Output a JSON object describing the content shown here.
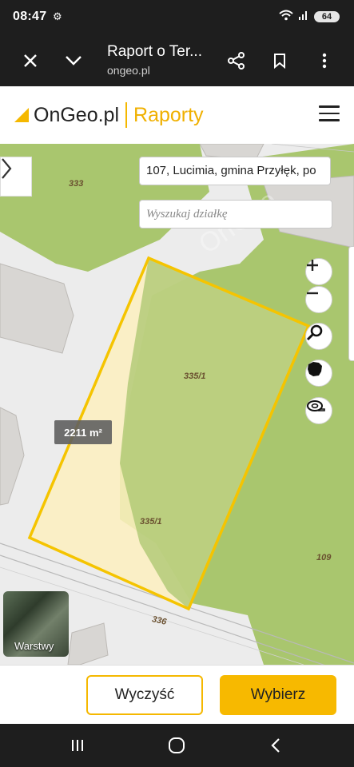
{
  "status": {
    "time": "08:47",
    "battery": "64"
  },
  "browser": {
    "title": "Raport o Ter...",
    "url": "ongeo.pl"
  },
  "header": {
    "brand": "OnGeo.pl",
    "section": "Raporty"
  },
  "map": {
    "address_value": "107, Lucimia, gmina Przyłęk, po",
    "search_placeholder": "Wyszukaj działkę",
    "area_badge": "2211 m²",
    "parcel_labels": [
      "333",
      "335/1",
      "335/1",
      "336",
      "109"
    ],
    "layers_label": "Warstwy",
    "colors": {
      "parcel_outline": "#f5c400",
      "vegetation": "#a9c66e",
      "selection_fill": "#fdf0c0"
    }
  },
  "actions": {
    "clear_label": "Wyczyść",
    "select_label": "Wybierz",
    "accent": "#f7b900"
  }
}
